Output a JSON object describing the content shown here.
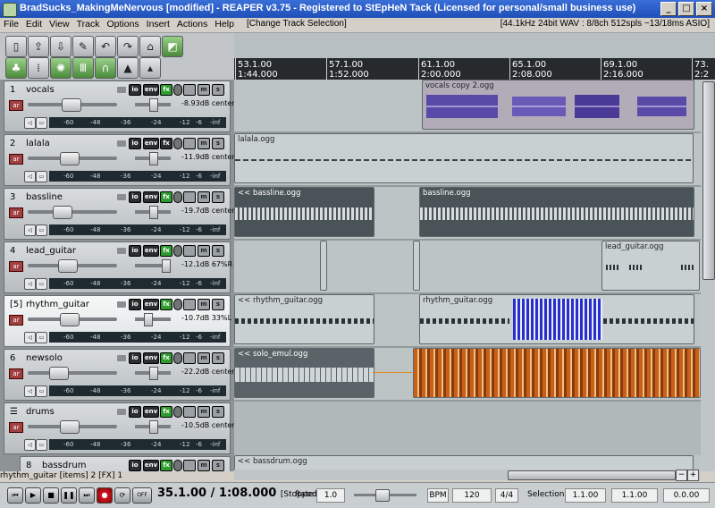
{
  "window": {
    "title": "BradSucks_MakingMeNervous [modified] - REAPER v3.75 - Registered to StEpHeN Tack (Licensed for personal/small business use)",
    "minimize": "_",
    "maximize": "□",
    "close": "×"
  },
  "menu": {
    "items": [
      "File",
      "Edit",
      "View",
      "Track",
      "Options",
      "Insert",
      "Actions",
      "Help"
    ],
    "last_action": "[Change Track Selection]",
    "audio_status": "[44.1kHz 24bit WAV : 8/8ch 512spls ~13/18ms ASIO]"
  },
  "ruler": {
    "marks": [
      {
        "bar": "53.1.00",
        "time": "1:44.000"
      },
      {
        "bar": "57.1.00",
        "time": "1:52.000"
      },
      {
        "bar": "61.1.00",
        "time": "2:00.000"
      },
      {
        "bar": "65.1.00",
        "time": "2:08.000"
      },
      {
        "bar": "69.1.00",
        "time": "2:16.000"
      },
      {
        "bar": "73.",
        "time": "2:2"
      }
    ]
  },
  "tracks": [
    {
      "num": "1",
      "name": "vocals",
      "vol": "-8.93dB",
      "pan": "center",
      "selected": false
    },
    {
      "num": "2",
      "name": "lalala",
      "vol": "-11.9dB",
      "pan": "center",
      "selected": false
    },
    {
      "num": "3",
      "name": "bassline",
      "vol": "-19.7dB",
      "pan": "center",
      "selected": false
    },
    {
      "num": "4",
      "name": "lead_guitar",
      "vol": "-12.1dB",
      "pan": "67%R",
      "selected": false
    },
    {
      "num": "[5]",
      "name": "rhythm_guitar",
      "vol": "-10.7dB",
      "pan": "33%L",
      "selected": true
    },
    {
      "num": "6",
      "name": "newsolo",
      "vol": "-22.2dB",
      "pan": "center",
      "selected": false
    },
    {
      "num": "",
      "name": "drums",
      "vol": "-10.5dB",
      "pan": "center",
      "selected": false
    },
    {
      "num": "8",
      "name": "bassdrum",
      "vol": "",
      "pan": "",
      "selected": false
    }
  ],
  "track_buttons": {
    "io": "io",
    "env": "env",
    "fx": "fx",
    "mute": "m",
    "solo": "s",
    "arm": "ar"
  },
  "meter_scale": [
    "-60",
    "-48",
    "-36",
    "-24",
    "-12",
    "-6",
    "-inf"
  ],
  "items": {
    "vocals": "vocals copy 2.ogg",
    "lalala": "lalala.ogg",
    "bassline_a": "<< bassline.ogg",
    "bassline_b": "bassline.ogg",
    "lead_guitar": "lead_guitar.ogg",
    "rhythm_a": "<< rhythm_guitar.ogg",
    "rhythm_b": "rhythm_guitar.ogg",
    "newsolo": "<< solo_emul.ogg",
    "bassdrum": "<< bassdrum.ogg"
  },
  "status": {
    "selection_info": "rhythm_guitar [items] 2 [FX] 1"
  },
  "transport": {
    "position": "35.1.00 / 1:08.000",
    "state": "[Stopped]",
    "rate_label": "Rate:",
    "rate": "1.0",
    "bpm_label": "BPM",
    "bpm": "120",
    "timesig": "4/4",
    "selection_label": "Selection:",
    "sel_start": "1.1.00",
    "sel_end": "1.1.00",
    "sel_len": "0.0.00",
    "off": "OFF"
  },
  "colors": {
    "accent_fx": "#2f9a2f",
    "arm": "#a04040",
    "ruler": "#262a2c",
    "titlebar": "#1f4fb8"
  }
}
